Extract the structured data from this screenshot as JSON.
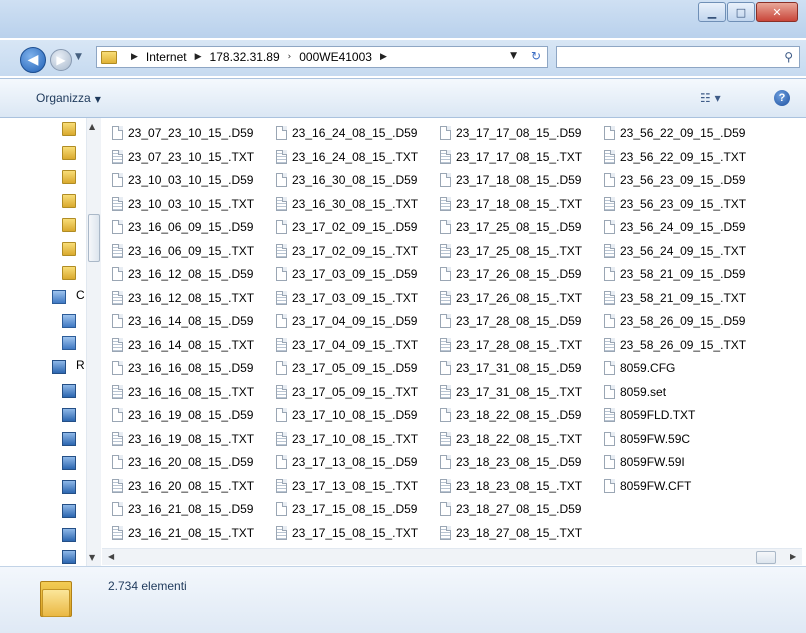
{
  "address": {
    "crumbs": [
      "Internet",
      "178.32.31.89",
      "000WE41003"
    ]
  },
  "toolbar": {
    "organize_label": "Organizza"
  },
  "nav_letters": [
    "C",
    "R"
  ],
  "files": {
    "col1": [
      "23_07_23_10_15_.D59",
      "23_07_23_10_15_.TXT",
      "23_10_03_10_15_.D59",
      "23_10_03_10_15_.TXT",
      "23_16_06_09_15_.D59",
      "23_16_06_09_15_.TXT",
      "23_16_12_08_15_.D59",
      "23_16_12_08_15_.TXT",
      "23_16_14_08_15_.D59",
      "23_16_14_08_15_.TXT",
      "23_16_16_08_15_.D59",
      "23_16_16_08_15_.TXT",
      "23_16_19_08_15_.D59",
      "23_16_19_08_15_.TXT",
      "23_16_20_08_15_.D59",
      "23_16_20_08_15_.TXT",
      "23_16_21_08_15_.D59",
      "23_16_21_08_15_.TXT"
    ],
    "col2": [
      "23_16_24_08_15_.D59",
      "23_16_24_08_15_.TXT",
      "23_16_30_08_15_.D59",
      "23_16_30_08_15_.TXT",
      "23_17_02_09_15_.D59",
      "23_17_02_09_15_.TXT",
      "23_17_03_09_15_.D59",
      "23_17_03_09_15_.TXT",
      "23_17_04_09_15_.D59",
      "23_17_04_09_15_.TXT",
      "23_17_05_09_15_.D59",
      "23_17_05_09_15_.TXT",
      "23_17_10_08_15_.D59",
      "23_17_10_08_15_.TXT",
      "23_17_13_08_15_.D59",
      "23_17_13_08_15_.TXT",
      "23_17_15_08_15_.D59",
      "23_17_15_08_15_.TXT"
    ],
    "col3": [
      "23_17_17_08_15_.D59",
      "23_17_17_08_15_.TXT",
      "23_17_18_08_15_.D59",
      "23_17_18_08_15_.TXT",
      "23_17_25_08_15_.D59",
      "23_17_25_08_15_.TXT",
      "23_17_26_08_15_.D59",
      "23_17_26_08_15_.TXT",
      "23_17_28_08_15_.D59",
      "23_17_28_08_15_.TXT",
      "23_17_31_08_15_.D59",
      "23_17_31_08_15_.TXT",
      "23_18_22_08_15_.D59",
      "23_18_22_08_15_.TXT",
      "23_18_23_08_15_.D59",
      "23_18_23_08_15_.TXT",
      "23_18_27_08_15_.D59",
      "23_18_27_08_15_.TXT"
    ],
    "col4": [
      "23_56_22_09_15_.D59",
      "23_56_22_09_15_.TXT",
      "23_56_23_09_15_.D59",
      "23_56_23_09_15_.TXT",
      "23_56_24_09_15_.D59",
      "23_56_24_09_15_.TXT",
      "23_58_21_09_15_.D59",
      "23_58_21_09_15_.TXT",
      "23_58_26_09_15_.D59",
      "23_58_26_09_15_.TXT",
      "8059.CFG",
      "8059.set",
      "8059FLD.TXT",
      "8059FW.59C",
      "8059FW.59I",
      "8059FW.CFT"
    ]
  },
  "status": {
    "count_text": "2.734 elementi"
  },
  "colors": {
    "titlebar": "#c6daf0",
    "close_button": "#c9463a",
    "folder": "#eab843"
  },
  "icons": [
    "back-icon",
    "forward-icon",
    "folder-icon",
    "refresh-icon",
    "search-icon",
    "view-options-icon",
    "help-icon",
    "file-icon",
    "minimize-icon",
    "maximize-icon",
    "close-icon"
  ]
}
